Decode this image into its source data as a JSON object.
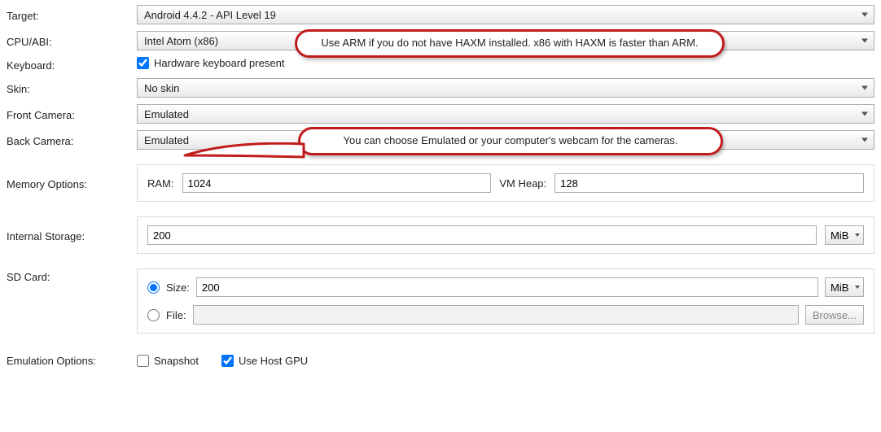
{
  "labels": {
    "target": "Target:",
    "cpu": "CPU/ABI:",
    "keyboard": "Keyboard:",
    "skin": "Skin:",
    "front_camera": "Front Camera:",
    "back_camera": "Back Camera:",
    "memory": "Memory Options:",
    "ram": "RAM:",
    "vmheap": "VM Heap:",
    "internal_storage": "Internal Storage:",
    "sdcard": "SD Card:",
    "sd_size": "Size:",
    "sd_file": "File:",
    "browse": "Browse...",
    "emu_options": "Emulation Options:",
    "snapshot": "Snapshot",
    "use_host_gpu": "Use Host GPU",
    "hw_keyboard": "Hardware keyboard present"
  },
  "values": {
    "target": "Android 4.4.2 - API Level 19",
    "cpu": "Intel Atom (x86)",
    "skin": "No skin",
    "front_camera": "Emulated",
    "back_camera": "Emulated",
    "ram": "1024",
    "vmheap": "128",
    "internal_storage": "200",
    "internal_storage_unit": "MiB",
    "sd_size": "200",
    "sd_size_unit": "MiB",
    "hw_keyboard_checked": true,
    "snapshot_checked": false,
    "use_host_gpu_checked": true,
    "sd_mode_size": true
  },
  "callouts": {
    "cpu": "Use ARM if you do not have HAXM installed.  x86 with HAXM is faster than ARM.",
    "camera": "You can choose Emulated or your computer's webcam for the cameras."
  }
}
